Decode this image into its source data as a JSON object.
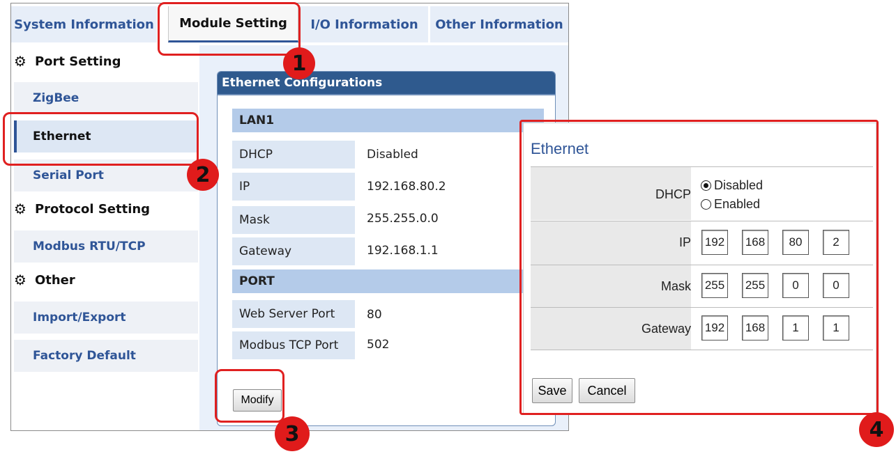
{
  "tabs": [
    {
      "label": "System Information"
    },
    {
      "label": "Module Setting"
    },
    {
      "label": "I/O Information"
    },
    {
      "label": "Other Information"
    }
  ],
  "menu": {
    "port_setting": "Port Setting",
    "zigbee": "ZigBee",
    "ethernet": "Ethernet",
    "serial_port": "Serial Port",
    "protocol_setting": "Protocol Setting",
    "modbus": "Modbus RTU/TCP",
    "other": "Other",
    "import_export": "Import/Export",
    "factory_default": "Factory Default"
  },
  "eth_config": {
    "title": "Ethernet Configurations",
    "lan_section": "LAN1",
    "dhcp_label": "DHCP",
    "dhcp_value": "Disabled",
    "ip_label": "IP",
    "ip_value": "192.168.80.2",
    "mask_label": "Mask",
    "mask_value": "255.255.0.0",
    "gateway_label": "Gateway",
    "gateway_value": "192.168.1.1",
    "port_section": "PORT",
    "web_port_label": "Web Server Port",
    "web_port_value": "80",
    "modbus_port_label": "Modbus TCP Port",
    "modbus_port_value": "502",
    "modify_label": "Modify"
  },
  "popup": {
    "title": "Ethernet",
    "dhcp_label": "DHCP",
    "dhcp_disabled": "Disabled",
    "dhcp_enabled": "Enabled",
    "ip_label": "IP",
    "ip": [
      "192",
      "168",
      "80",
      "2"
    ],
    "mask_label": "Mask",
    "mask": [
      "255",
      "255",
      "0",
      "0"
    ],
    "gateway_label": "Gateway",
    "gateway": [
      "192",
      "168",
      "1",
      "1"
    ],
    "save_label": "Save",
    "cancel_label": "Cancel"
  },
  "callouts": [
    "1",
    "2",
    "3",
    "4"
  ],
  "colors": {
    "accent": "#2f5597",
    "highlight": "#e02020",
    "header": "#2f5a8e"
  }
}
